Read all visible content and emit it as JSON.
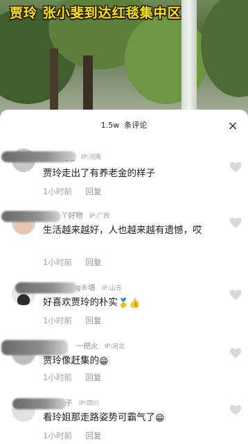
{
  "video": {
    "title": "贾玲  张小斐到达红毯集中区"
  },
  "sheet": {
    "count_label": "1.5w",
    "count_suffix": "条评论",
    "close_label": "×"
  },
  "comments": [
    {
      "name_tail": "_ _",
      "ip": "IP:河南",
      "text": "贾玲走出了有养老金的样子",
      "time": "1小时前",
      "reply": "回复"
    },
    {
      "name_tail": "丫好物",
      "ip": "IP:广西",
      "text": "生活越来越好，人也越来越有遗憾，哎",
      "time": "1小时前",
      "reply": "回复"
    },
    {
      "name_tail": "g®墙",
      "ip": "IP:山东",
      "text": "好喜欢贾玲的朴实",
      "emoji_suffix": "🥇👍",
      "time": "1小时前",
      "reply": "回复"
    },
    {
      "name_tail": "一把火",
      "ip": "IP:河北",
      "text": "贾玲像赶集的",
      "emoji_suffix": "😁",
      "time": "1小时前",
      "reply": "回复"
    },
    {
      "name_tail": "子",
      "ip": "IP:四川",
      "text": "看玲姐那走路姿势可霸气了",
      "emoji_suffix": "😁",
      "time": "1小时前",
      "reply": "回复"
    }
  ],
  "icons": {
    "like": "heart-icon",
    "close": "close-icon"
  }
}
